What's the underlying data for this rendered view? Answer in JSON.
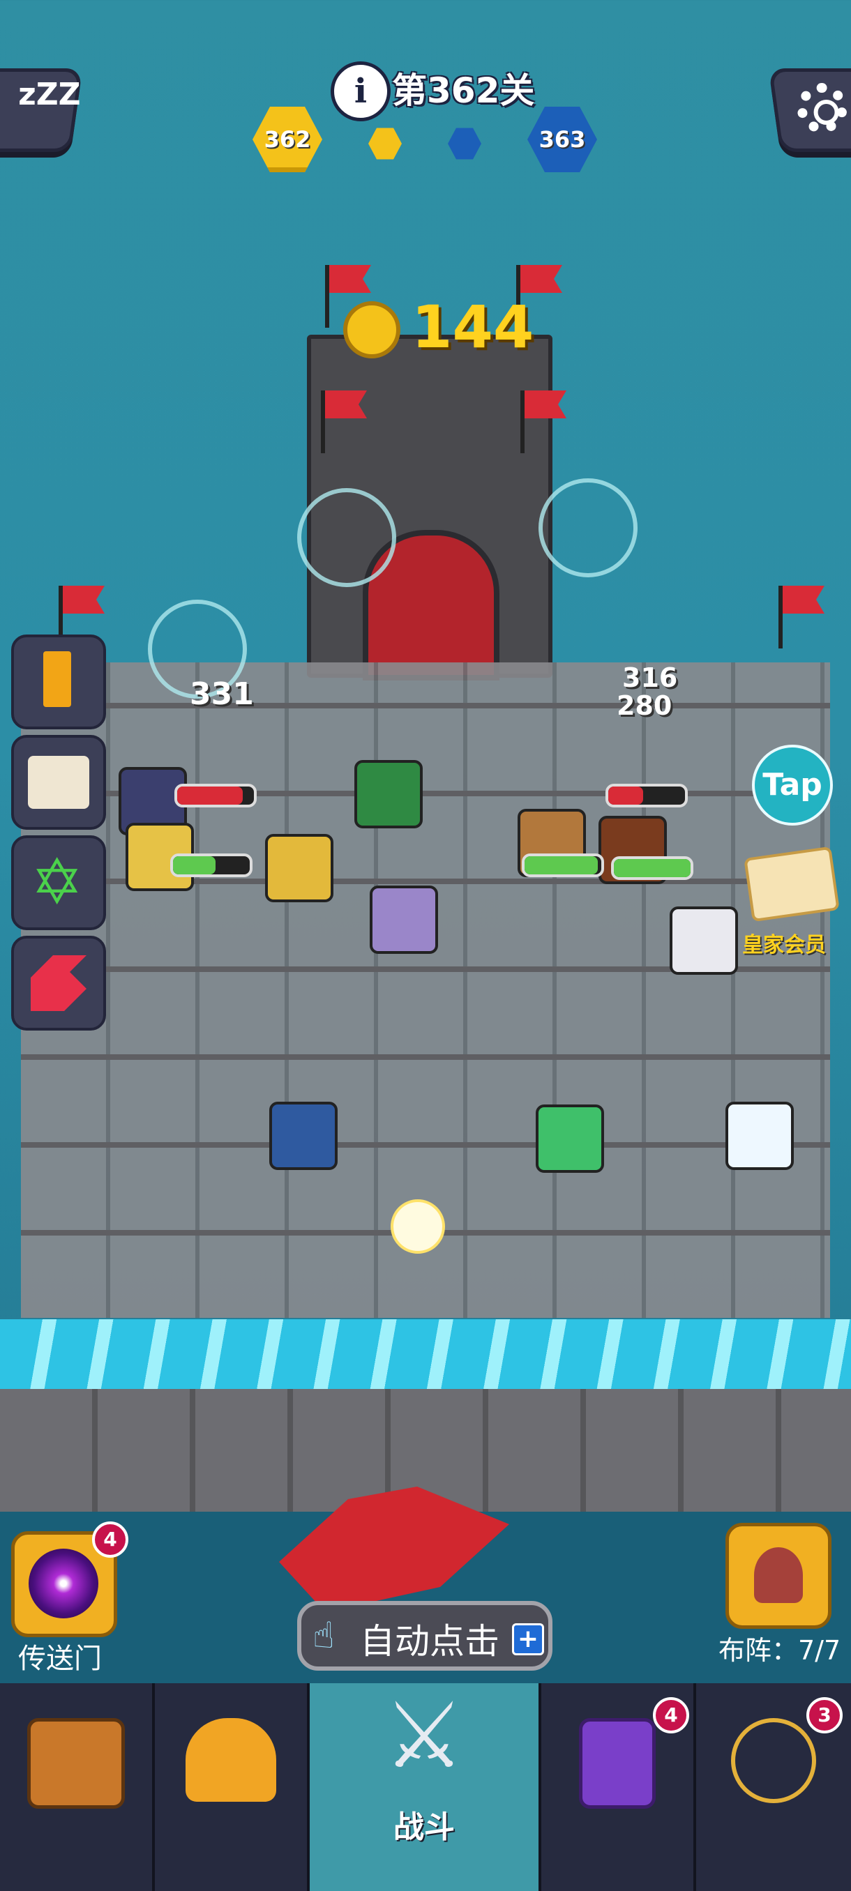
{
  "top": {
    "info_icon": "info-icon",
    "level_title": "第362关",
    "current_level_badge": "362",
    "next_level_badge": "363",
    "sleep_icon_text": "zZZ"
  },
  "board": {
    "coin_value": "144",
    "damage_left": "331",
    "damage_right_1": "316",
    "damage_right_2": "280",
    "tap_label": "Tap",
    "vip_label": "皇家会员",
    "enemy_hp": [
      0.85,
      0.45
    ],
    "ally_hp": [
      0.55,
      0.95,
      1.0
    ]
  },
  "bottom": {
    "portal_label": "传送门",
    "portal_badge": "4",
    "auto_click_label": "自动点击",
    "auto_plus": "+",
    "formation_label": "布阵：7/7"
  },
  "tabs": [
    {
      "id": "chest",
      "label": "",
      "badge": ""
    },
    {
      "id": "helmet",
      "label": "",
      "badge": ""
    },
    {
      "id": "battle",
      "label": "战斗",
      "badge": ""
    },
    {
      "id": "spellbook",
      "label": "",
      "badge": "4"
    },
    {
      "id": "amulet",
      "label": "",
      "badge": "3"
    }
  ],
  "colors": {
    "accent_gold": "#ffd21f",
    "enemy_red": "#d92b37",
    "ally_green": "#5ec94f",
    "active_tab": "#3f9aa8"
  }
}
